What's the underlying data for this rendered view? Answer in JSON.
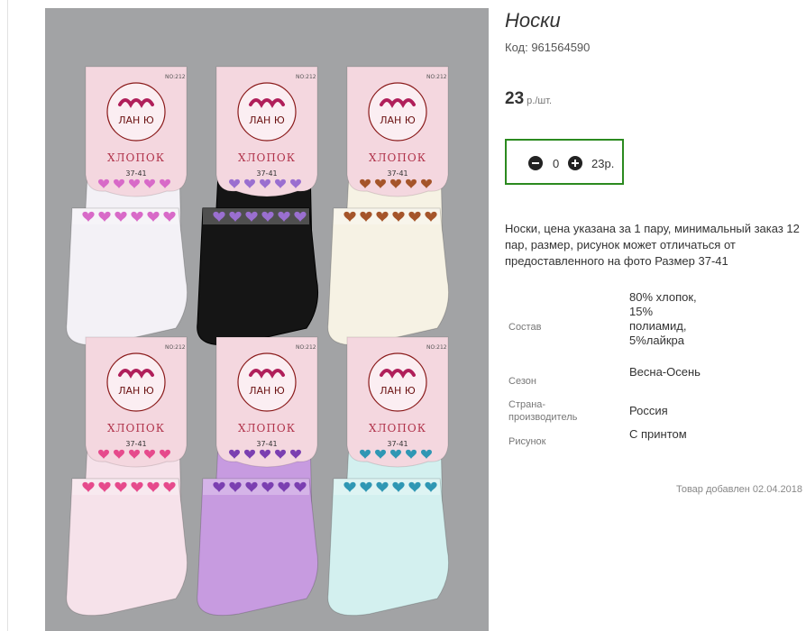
{
  "product": {
    "title": "Носки",
    "code": "Код: 961564590",
    "price_value": "23",
    "price_unit": "р./шт."
  },
  "quantity": {
    "value": "0",
    "sum": "23р.",
    "border_color": "#2b8a1f"
  },
  "description": "Носки, цена указана за 1 пару, минимальный заказ 12 пар, размер, рисунок может отличаться от предоставленного на фото Размер 37-41",
  "specs": [
    {
      "key": "Состав",
      "value": "80% хлопок, 15% полиамид, 5%лайкра"
    },
    {
      "key": "Сезон",
      "value": "Весна-Осень"
    },
    {
      "key": "Страна-производитель",
      "value": "Россия"
    },
    {
      "key": "Рисунок",
      "value": "С принтом"
    }
  ],
  "added": "Товар добавлен 02.04.2018",
  "photo": {
    "tag_model": "NO:212",
    "tag_brand": "ЛАН Ю",
    "tag_material": "ХЛОПОК",
    "tag_size": "37-41",
    "sock_colors": [
      "#f3f1f6",
      "#151515",
      "#f6f2e4",
      "#f6e2ea",
      "#c79be0",
      "#d3f0ef"
    ],
    "heart_colors": [
      "#d86ac8",
      "#9a6fd0",
      "#a5552a",
      "#e64a8c",
      "#7b3fb1",
      "#2f97b4"
    ],
    "tag_color": "#f4d7df"
  }
}
